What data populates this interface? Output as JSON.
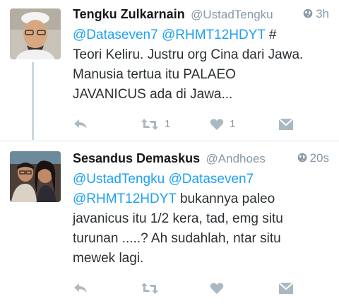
{
  "tweets": [
    {
      "name": "Tengku Zulkarnain",
      "handle": "@UstadTengku",
      "time": "3h",
      "mentions": "@Dataseven7 @RHMT12HDYT",
      "text_after_mentions": " #",
      "text_lines": [
        "Teori Keliru. Justru org Cina dari Jawa.",
        "Manusia tertua itu PALAEO",
        "JAVANICUS ada di Jawa..."
      ],
      "retweet_count": "1",
      "like_count": "1"
    },
    {
      "name": "Sesandus Demaskus",
      "handle": "@Andhoes",
      "time": "20s",
      "mentions_line1": "@UstadTengku @Dataseven7",
      "mention_line2": "@RHMT12HDYT",
      "line2_rest": " bukannya paleo",
      "text_lines": [
        "javanicus itu 1/2 kera, tad, emg situ",
        "turunan .....? Ah sudahlah, ntar situ",
        "mewek lagi."
      ],
      "retweet_count": "",
      "like_count": ""
    }
  ],
  "icons": {
    "globe": "globe-icon",
    "reply": "reply-icon",
    "retweet": "retweet-icon",
    "like": "heart-icon",
    "dm": "direct-message-icon"
  },
  "colors": {
    "mention": "#1da1f2",
    "muted": "#8899a6",
    "action_icon": "#aab8c2",
    "divider": "#e1e8ed"
  }
}
